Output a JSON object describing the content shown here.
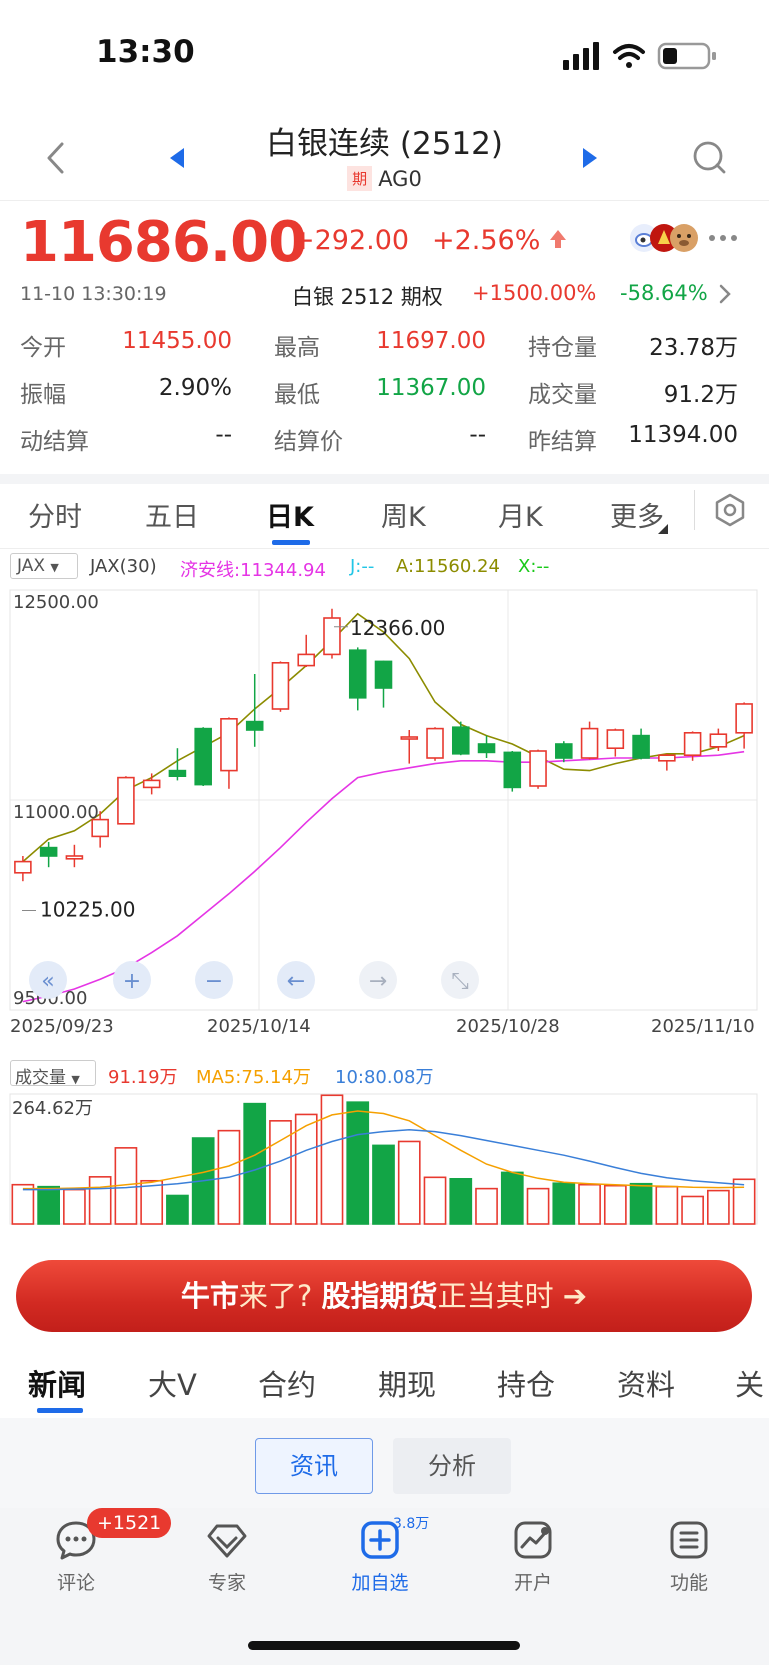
{
  "status_bar": {
    "time": "13:30"
  },
  "nav": {
    "title": "白银连续 (2512)",
    "badge": "期",
    "code": "AG0"
  },
  "quote": {
    "price": "11686.00",
    "change": "+292.00",
    "change_pct": "+2.56%",
    "timestamp": "11-10 13:30:19",
    "option_label": "白银 2512 期权",
    "option_up": "+1500.00%",
    "option_down": "-58.64%"
  },
  "stats": [
    {
      "label": "今开",
      "value": "11455.00",
      "color": "red"
    },
    {
      "label": "最高",
      "value": "11697.00",
      "color": "red"
    },
    {
      "label": "持仓量",
      "value": "23.78万",
      "color": "black"
    },
    {
      "label": "振幅",
      "value": "2.90%",
      "color": "black"
    },
    {
      "label": "最低",
      "value": "11367.00",
      "color": "green"
    },
    {
      "label": "成交量",
      "value": "91.2万",
      "color": "black"
    },
    {
      "label": "动结算",
      "value": "--",
      "color": "black"
    },
    {
      "label": "结算价",
      "value": "--",
      "color": "black"
    },
    {
      "label": "昨结算",
      "value": "11394.00",
      "color": "black"
    }
  ],
  "chart_tabs": [
    "分时",
    "五日",
    "日K",
    "周K",
    "月K",
    "更多"
  ],
  "indicator": {
    "select": "JAX",
    "name": "JAX(30)",
    "jian": "济安线:11344.94",
    "j": "J:--",
    "a": "A:11560.24",
    "x": "X:--"
  },
  "volume_header": {
    "select": "成交量",
    "vol": "91.19万",
    "ma5": "MA5:75.14万",
    "ma10": "10:80.08万"
  },
  "banner": {
    "part1": "牛市",
    "part2": "来了? ",
    "part3": "股指期货",
    "part4": "正当其时 ➔"
  },
  "news_tabs": [
    "新闻",
    "大V",
    "合约",
    "期现",
    "持仓",
    "资料",
    "关"
  ],
  "sub_tabs": [
    "资讯",
    "分析"
  ],
  "bottom_nav": {
    "items": [
      "评论",
      "专家",
      "加自选",
      "开户",
      "功能"
    ],
    "comment_badge": "+1521",
    "add_count": "3.8万"
  },
  "colors": {
    "up": "#e8392f",
    "down": "#12a546",
    "accent": "#1e6be8",
    "jian": "#e535e5",
    "a_line": "#8c8c00"
  },
  "chart_data": [
    {
      "type": "candlestick",
      "title": "",
      "y_range": [
        9500,
        12500
      ],
      "y_ticks": [
        "12500.00",
        "11000.00",
        "9500.00"
      ],
      "x_ticks": [
        "2025/09/23",
        "2025/10/14",
        "2025/10/28",
        "2025/11/10"
      ],
      "max_label": "12366.00",
      "min_label": "10225.00",
      "candles": [
        {
          "open": 10480,
          "close": 10560,
          "high": 10600,
          "low": 10420
        },
        {
          "open": 10660,
          "close": 10600,
          "high": 10700,
          "low": 10520
        },
        {
          "open": 10580,
          "close": 10600,
          "high": 10680,
          "low": 10520
        },
        {
          "open": 10740,
          "close": 10860,
          "high": 10920,
          "low": 10660
        },
        {
          "open": 10830,
          "close": 11160,
          "high": 11170,
          "low": 10830
        },
        {
          "open": 11090,
          "close": 11140,
          "high": 11190,
          "low": 11040
        },
        {
          "open": 11210,
          "close": 11170,
          "high": 11370,
          "low": 11140
        },
        {
          "open": 11510,
          "close": 11110,
          "high": 11520,
          "low": 11100
        },
        {
          "open": 11210,
          "close": 11580,
          "high": 11590,
          "low": 11080
        },
        {
          "open": 11560,
          "close": 11500,
          "high": 11900,
          "low": 11380
        },
        {
          "open": 11650,
          "close": 11980,
          "high": 11990,
          "low": 11630
        },
        {
          "open": 11960,
          "close": 12040,
          "high": 12180,
          "low": 11950
        },
        {
          "open": 12040,
          "close": 12300,
          "high": 12366,
          "low": 12010
        },
        {
          "open": 12070,
          "close": 11730,
          "high": 12090,
          "low": 11640
        },
        {
          "open": 11990,
          "close": 11800,
          "high": 11995,
          "low": 11660
        },
        {
          "open": 11440,
          "close": 11450,
          "high": 11500,
          "low": 11260
        },
        {
          "open": 11300,
          "close": 11510,
          "high": 11520,
          "low": 11280
        },
        {
          "open": 11520,
          "close": 11330,
          "high": 11560,
          "low": 11320
        },
        {
          "open": 11400,
          "close": 11340,
          "high": 11460,
          "low": 11300
        },
        {
          "open": 11340,
          "close": 11090,
          "high": 11350,
          "low": 11060
        },
        {
          "open": 11100,
          "close": 11350,
          "high": 11360,
          "low": 11080
        },
        {
          "open": 11400,
          "close": 11300,
          "high": 11420,
          "low": 11270
        },
        {
          "open": 11300,
          "close": 11510,
          "high": 11560,
          "low": 11290
        },
        {
          "open": 11370,
          "close": 11500,
          "high": 11510,
          "low": 11310
        },
        {
          "open": 11460,
          "close": 11300,
          "high": 11510,
          "low": 11290
        },
        {
          "open": 11280,
          "close": 11320,
          "high": 11330,
          "low": 11210
        },
        {
          "open": 11320,
          "close": 11480,
          "high": 11490,
          "low": 11280
        },
        {
          "open": 11380,
          "close": 11470,
          "high": 11510,
          "low": 11350
        },
        {
          "open": 11480,
          "close": 11686,
          "high": 11697,
          "low": 11367
        }
      ],
      "series": [
        {
          "name": "A",
          "values": [
            10560,
            10720,
            10780,
            10900,
            11070,
            11160,
            11280,
            11380,
            11480,
            11650,
            11800,
            11960,
            12140,
            12330,
            12200,
            12010,
            11700,
            11540,
            11460,
            11400,
            11310,
            11220,
            11210,
            11260,
            11300,
            11330,
            11330,
            11380,
            11460
          ]
        },
        {
          "name": "济安线",
          "values": [
            9560,
            9600,
            9650,
            9720,
            9800,
            9910,
            10030,
            10180,
            10330,
            10490,
            10660,
            10840,
            11010,
            11160,
            11200,
            11230,
            11260,
            11280,
            11280,
            11270,
            11270,
            11280,
            11290,
            11300,
            11300,
            11300,
            11310,
            11320,
            11345
          ]
        }
      ]
    },
    {
      "type": "bar",
      "title": "",
      "y_max_label": "264.62万",
      "y_max": 264.62,
      "values": [
        80,
        76,
        70,
        96,
        155,
        88,
        58,
        175,
        190,
        245,
        210,
        223,
        262,
        248,
        160,
        168,
        95,
        92,
        72,
        105,
        72,
        83,
        80,
        78,
        82,
        76,
        56,
        68,
        91
      ],
      "directions": [
        "up",
        "down",
        "up",
        "up",
        "up",
        "up",
        "down",
        "down",
        "up",
        "down",
        "up",
        "up",
        "up",
        "down",
        "down",
        "up",
        "up",
        "down",
        "up",
        "down",
        "up",
        "down",
        "up",
        "up",
        "down",
        "up",
        "up",
        "up",
        "up"
      ],
      "series": [
        {
          "name": "MA5",
          "values": [
            72,
            72,
            73,
            75,
            80,
            85,
            95,
            105,
            118,
            140,
            170,
            200,
            222,
            230,
            225,
            210,
            180,
            150,
            122,
            105,
            93,
            85,
            82,
            80,
            78,
            77,
            75,
            74,
            75
          ]
        },
        {
          "name": "10",
          "values": [
            70,
            70,
            71,
            72,
            74,
            78,
            82,
            88,
            95,
            110,
            128,
            150,
            168,
            182,
            188,
            192,
            188,
            180,
            170,
            160,
            150,
            140,
            128,
            115,
            103,
            94,
            88,
            84,
            80
          ]
        }
      ]
    }
  ]
}
